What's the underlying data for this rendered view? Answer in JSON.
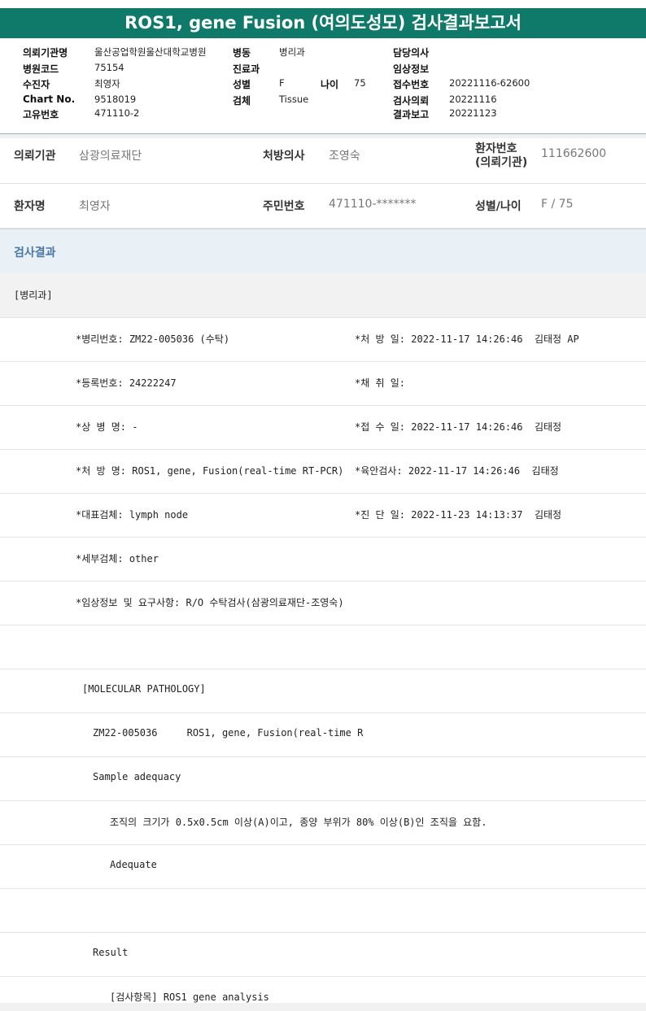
{
  "report": {
    "title": "ROS1, gene Fusion (여의도성모) 검사결과보고서"
  },
  "header": {
    "institution_label": "의뢰기관명",
    "institution_value": "울산공업학원울산대학교병원",
    "ward_label": "병동",
    "ward_value": "병리과",
    "doctor_label": "담당의사",
    "doctor_value": "",
    "hospital_code_label": "병원코드",
    "hospital_code_value": "75154",
    "dept_label": "진료과",
    "dept_value": "",
    "clinical_label": "임상정보",
    "clinical_value": "",
    "patient_label": "수진자",
    "patient_value": "최영자",
    "sex_label": "성별",
    "sex_value": "F",
    "age_label": "나이",
    "age_value": "75",
    "reception_label": "접수번호",
    "reception_value": "20221116-62600",
    "chart_label": "Chart No.",
    "chart_value": "9518019",
    "specimen_label": "검체",
    "specimen_value": "Tissue",
    "request_label": "검사의뢰",
    "request_value": "20221116",
    "unique_label": "고유번호",
    "unique_value": "471110-2",
    "result_report_label": "결과보고",
    "result_report_value": "20221123"
  },
  "patient_info": {
    "institution_label": "의뢰기관",
    "institution_value": "삼광의료재단",
    "prescriber_label": "처방의사",
    "prescriber_value": "조영숙",
    "patient_no_label_1": "환자번호",
    "patient_no_label_2": "(의뢰기관)",
    "patient_no_value": "111662600",
    "patient_name_label": "환자명",
    "patient_name_value": "최영자",
    "resident_no_label": "주민번호",
    "resident_no_value": "471110-*******",
    "sex_age_label": "성별/나이",
    "sex_age_value": "F / 75"
  },
  "results": {
    "section_title": "검사결과",
    "department": "[병리과]",
    "lines": [
      {
        "left": "*병리번호: ZM22-005036 (수탁)",
        "right": "*처 방 일: 2022-11-17 14:26:46  김태정 AP"
      },
      {
        "left": "*등록번호: 24222247",
        "right": "*채 취 일:"
      },
      {
        "left": "*상 병 명: -",
        "right": "*접 수 일: 2022-11-17 14:26:46  김태정"
      },
      {
        "left": "*처 방 명: ROS1, gene, Fusion(real-time RT-PCR)",
        "right": "*육안검사: 2022-11-17 14:26:46  김태정"
      },
      {
        "left": "*대표검체: lymph node",
        "right": "*진 단 일: 2022-11-23 14:13:37  김태정"
      },
      {
        "left": "*세부검체: other",
        "right": ""
      },
      {
        "left": "*임상정보 및 요구사항: R/O 수탁검사(삼광의료재단-조영숙)",
        "right": ""
      },
      {
        "left": "",
        "right": ""
      },
      {
        "left": "[MOLECULAR PATHOLOGY]",
        "right": ""
      },
      {
        "left": "ZM22-005036     ROS1, gene, Fusion(real-time R",
        "right": ""
      },
      {
        "left": "Sample adequacy",
        "right": ""
      },
      {
        "left": "조직의 크기가 0.5x0.5cm 이상(A)이고, 종양 부위가 80% 이상(B)인 조직을 요함.",
        "right": ""
      },
      {
        "left": "Adequate",
        "right": ""
      },
      {
        "left": "",
        "right": ""
      },
      {
        "left": "Result",
        "right": ""
      },
      {
        "left": "[검사항목] ROS1 gene analysis",
        "right": ""
      }
    ]
  }
}
